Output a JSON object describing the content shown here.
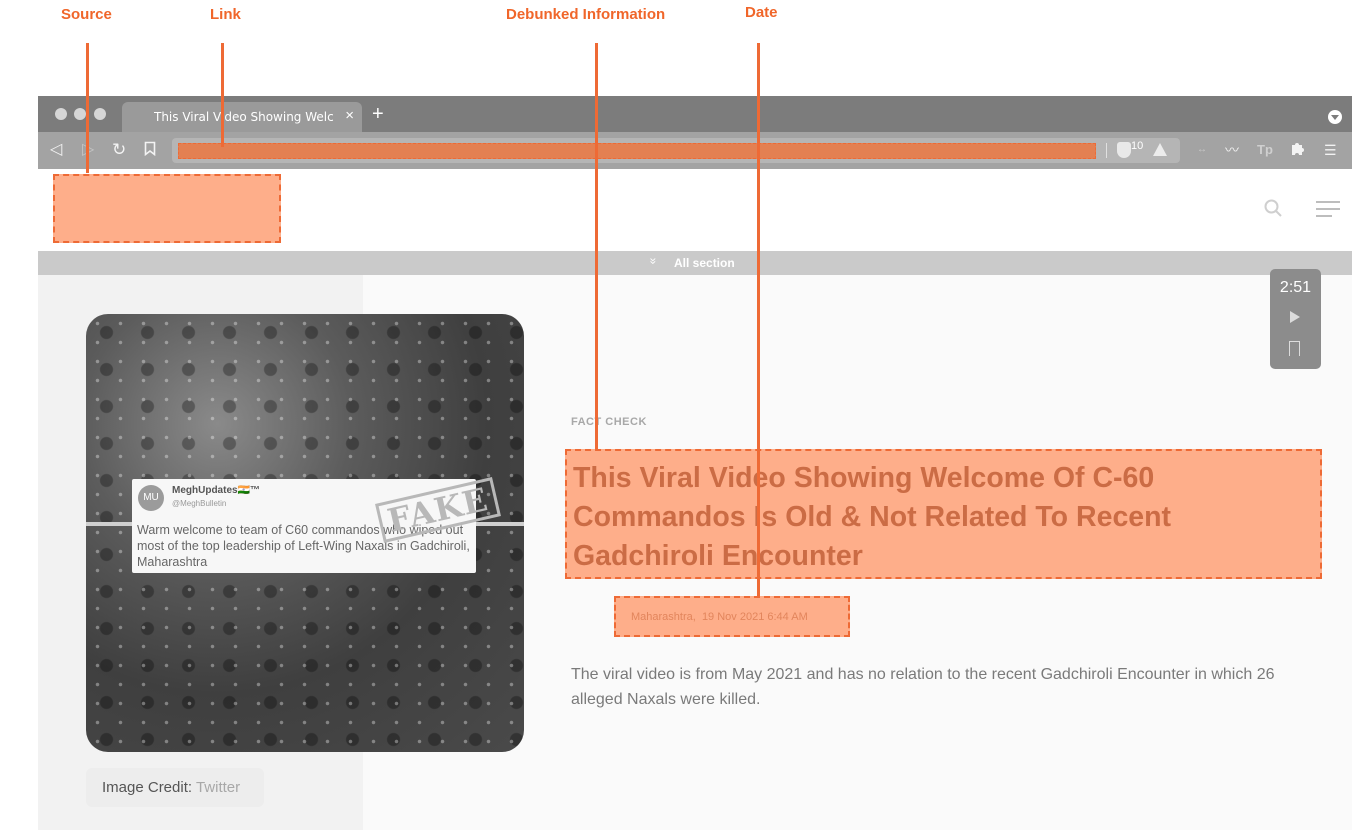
{
  "annotations": {
    "source": "Source",
    "link": "Link",
    "debunked": "Debunked Information",
    "date": "Date"
  },
  "browser": {
    "tab_title": "This Viral Video Showing Welco",
    "tab_close": "×",
    "new_tab": "+",
    "shield_count": "10"
  },
  "site": {
    "section_label": "All section",
    "section_icon": "»"
  },
  "player": {
    "time": "2:51"
  },
  "image": {
    "tweet_avatar": "MU",
    "tweet_name": "MeghUpdates🇮🇳™",
    "tweet_handle": "@MeghBulletin",
    "tweet_text": "Warm welcome to team of C60 commandos who wiped out most of the top leadership of Left-Wing Naxals in Gadchiroli, Maharashtra",
    "stamp": "FAKE",
    "credit_label": "Image Credit:",
    "credit_value": "Twitter"
  },
  "article": {
    "kicker": "FACT CHECK",
    "headline": "This Viral Video Showing Welcome Of C-60 Commandos Is Old & Not Related To Recent Gadchiroli Encounter",
    "location": "Maharashtra,",
    "date": "19 Nov 2021 6:44 AM",
    "summary": "The viral video is from May 2021 and has no relation to the recent Gadchiroli Encounter in which 26 alleged Naxals were killed."
  },
  "colors": {
    "annotation": "#ee6a35",
    "highlight": "#feae8a"
  }
}
